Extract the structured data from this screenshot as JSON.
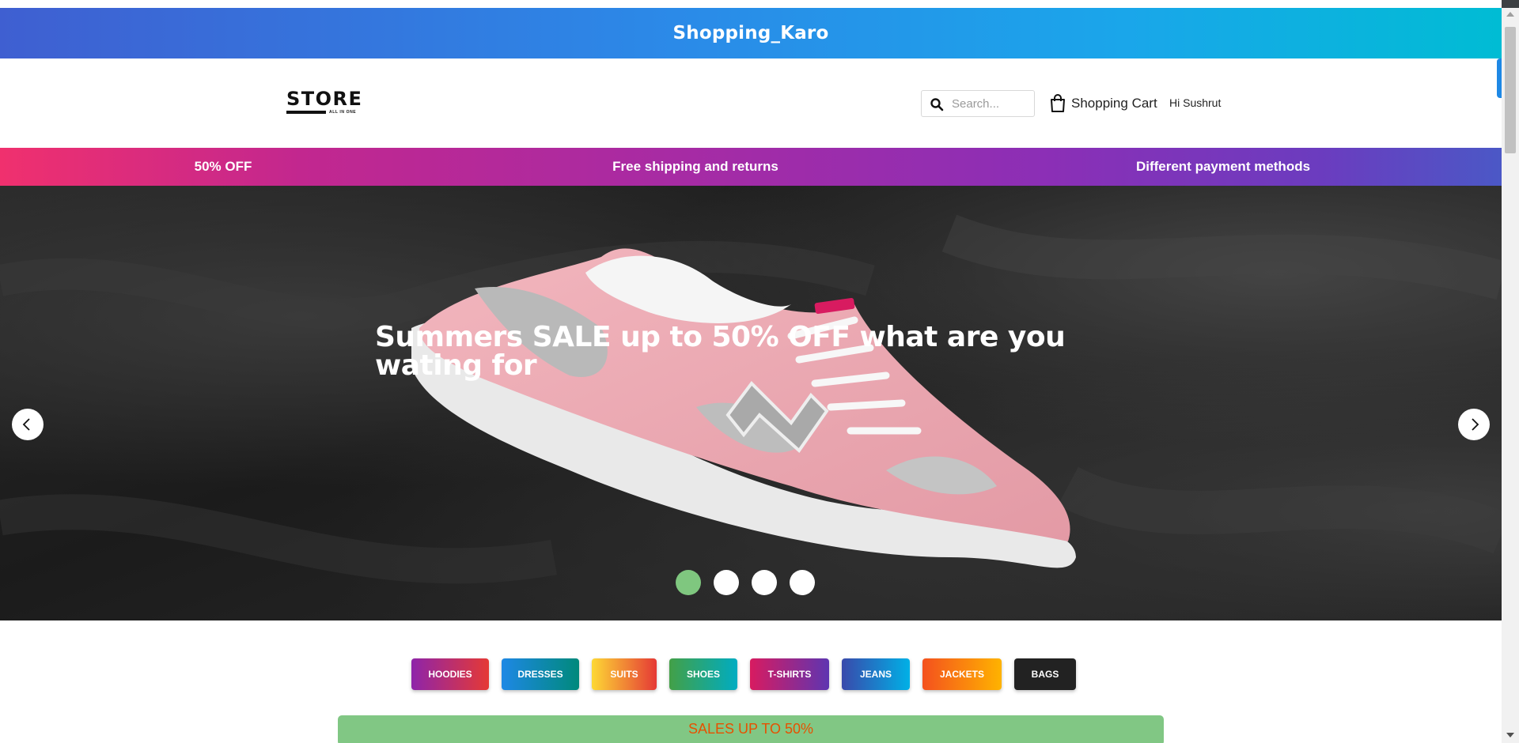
{
  "brand": {
    "title": "Shopping_Karo"
  },
  "navbar": {
    "logo_word": "STORE",
    "logo_tagline": "ALL IN ONE",
    "search_placeholder": "Search...",
    "cart_label": "Shopping Cart",
    "greeting": "Hi Sushrut"
  },
  "promo": {
    "items": [
      "50% OFF",
      "Free shipping and returns",
      "Different payment methods"
    ]
  },
  "hero": {
    "headline": "Summers SALE up to 50% OFF what are you wating for",
    "slides": {
      "count": 4,
      "active_index": 0
    },
    "prev_icon": "chevron-left-icon",
    "next_icon": "chevron-right-icon"
  },
  "categories": [
    {
      "label": "HOODIES",
      "gradient": [
        "#8e24aa",
        "#e53935"
      ]
    },
    {
      "label": "DRESSES",
      "gradient": [
        "#1e88e5",
        "#00897b"
      ]
    },
    {
      "label": "SUITS",
      "gradient": [
        "#fdd835",
        "#e53935"
      ]
    },
    {
      "label": "SHOES",
      "gradient": [
        "#43a047",
        "#00acc1"
      ]
    },
    {
      "label": "T-SHIRTS",
      "gradient": [
        "#d81b60",
        "#5e35b1"
      ]
    },
    {
      "label": "JEANS",
      "gradient": [
        "#3949ab",
        "#00b0e6"
      ]
    },
    {
      "label": "JACKETS",
      "gradient": [
        "#f4511e",
        "#ffb300"
      ]
    },
    {
      "label": "BAGS",
      "gradient": [
        "#222222",
        "#222222"
      ]
    }
  ],
  "sales_banner": "SALES UP TO 50%",
  "colors": {
    "dot_active": "#7fc77f",
    "sales_bg": "#81c784",
    "sales_text": "#e65100"
  }
}
